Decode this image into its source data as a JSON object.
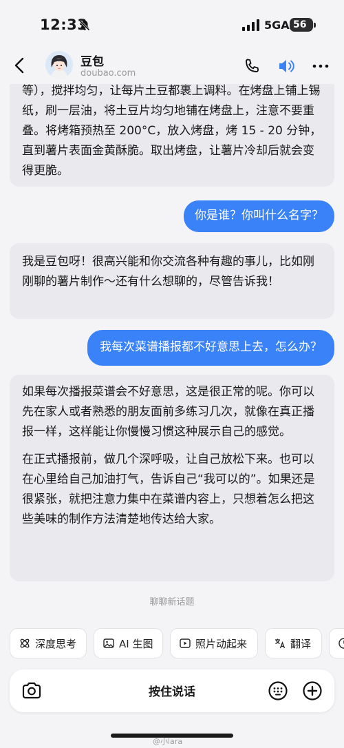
{
  "status": {
    "time": "12:33",
    "network": "5GA",
    "battery": "56"
  },
  "header": {
    "name": "豆包",
    "domain": "doubao.com"
  },
  "messages": [
    {
      "role": "bot",
      "paragraphs": [
        "等），搅拌均匀，让每片土豆都裹上调料。在烤盘上铺上锡纸，刷一层油，将土豆片均匀地铺在烤盘上，注意不要重叠。将烤箱预热至 200°C，放入烤盘，烤 15 - 20 分钟，直到薯片表面金黄酥脆。取出烤盘，让薯片冷却后就会变得更脆。"
      ]
    },
    {
      "role": "user",
      "text": "你是谁？你叫什么名字？"
    },
    {
      "role": "bot",
      "paragraphs": [
        "我是豆包呀！很高兴能和你交流各种有趣的事儿，比如刚刚聊的薯片制作～还有什么想聊的，尽管告诉我！"
      ]
    },
    {
      "role": "user",
      "text": "我每次菜谱播报都不好意思上去，怎么办？"
    },
    {
      "role": "bot",
      "paragraphs": [
        "如果每次播报菜谱会不好意思，这是很正常的呢。你可以先在家人或者熟悉的朋友面前多练习几次，就像在真正播报一样，这样能让你慢慢习惯这种展示自己的感觉。",
        "在正式播报前，做几个深呼吸，让自己放松下来。也可以在心里给自己加油打气，告诉自己“我可以的”。如果还是很紧张，就把注意力集中在菜谱内容上，只想着怎么把这些美味的制作方法清楚地传达给大家。"
      ]
    }
  ],
  "new_topic": "聊聊新话题",
  "chips": [
    {
      "label": "深度思考",
      "icon": "atom-icon"
    },
    {
      "label": "AI 生图",
      "icon": "image-icon"
    },
    {
      "label": "照片动起来",
      "icon": "play-icon"
    },
    {
      "label": "翻译",
      "icon": "translate-icon"
    }
  ],
  "input": {
    "hold_to_talk": "按住说话"
  },
  "watermark": "@小lara",
  "colors": {
    "accent": "#3a82f7",
    "bot_bubble": "#e9e9ee",
    "background": "#f4f4f6"
  }
}
